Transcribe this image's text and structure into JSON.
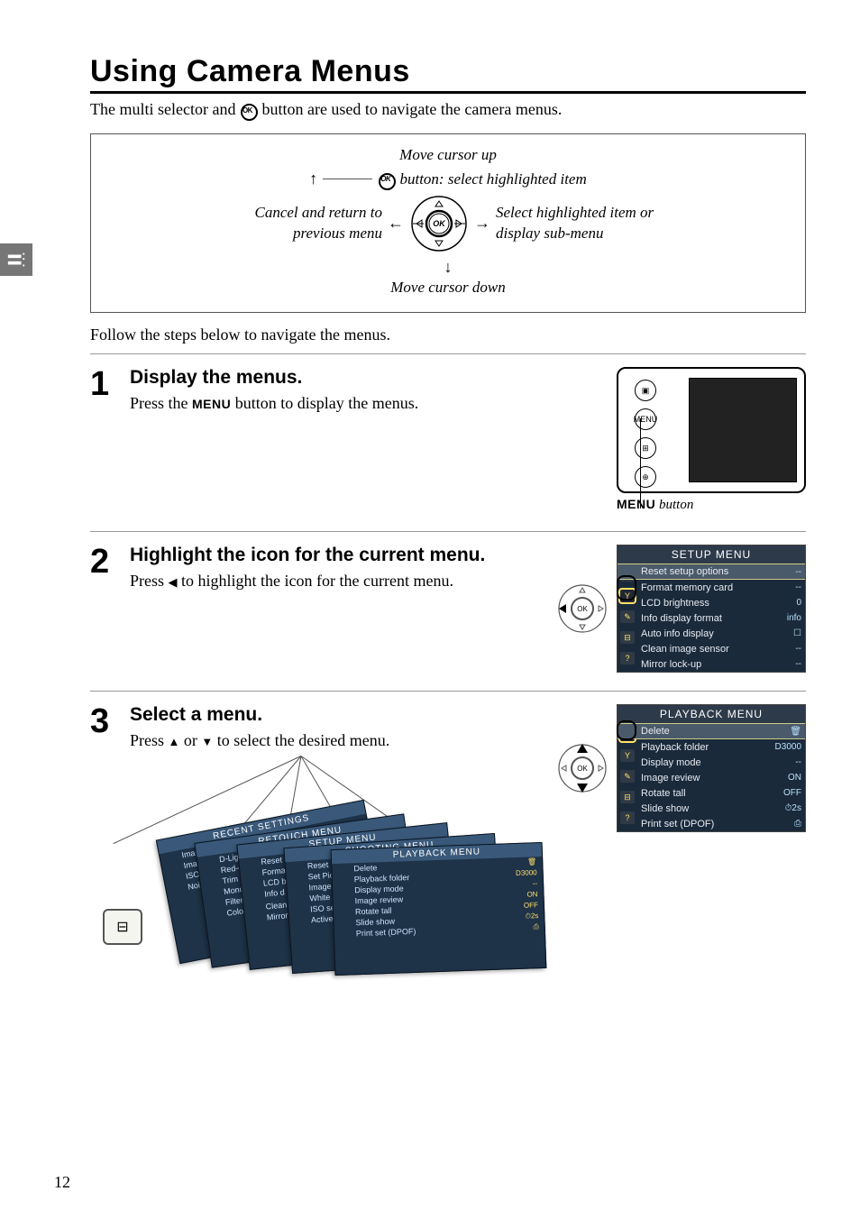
{
  "page_number": "12",
  "heading": "Using Camera Menus",
  "intro_pre": "The multi selector and ",
  "intro_post": " button are used to navigate the camera menus.",
  "diagram": {
    "up": "Move cursor up",
    "down": "Move cursor down",
    "ok": " button: select highlighted item",
    "right": "Select highlighted item or display sub-menu",
    "left": "Cancel and return to previous menu"
  },
  "follow": "Follow the steps below to navigate the menus.",
  "steps": [
    {
      "num": "1",
      "title": "Display the menus.",
      "text_pre": "Press the ",
      "text_mid": "MENU",
      "text_post": " button to display the menus.",
      "caption_pre": "MENU",
      "caption_post": " button"
    },
    {
      "num": "2",
      "title": "Highlight the icon for the current menu.",
      "text_pre": "Press ",
      "text_post": " to highlight the icon for the current menu."
    },
    {
      "num": "3",
      "title": "Select a menu.",
      "text_pre": "Press ",
      "text_mid": " or ",
      "text_post": " to select the desired menu."
    }
  ],
  "setup_menu": {
    "title": "SETUP MENU",
    "items": [
      {
        "label": "Reset setup options",
        "val": "--"
      },
      {
        "label": "Format memory card",
        "val": "--"
      },
      {
        "label": "LCD brightness",
        "val": "0"
      },
      {
        "label": "Info display format",
        "val": "info"
      },
      {
        "label": "Auto info display",
        "val": "☐"
      },
      {
        "label": "Clean image sensor",
        "val": "--"
      },
      {
        "label": "Mirror lock-up",
        "val": "--"
      }
    ]
  },
  "playback_menu": {
    "title": "PLAYBACK MENU",
    "items": [
      {
        "label": "Delete",
        "val": "🗑"
      },
      {
        "label": "Playback folder",
        "val": "D3000"
      },
      {
        "label": "Display mode",
        "val": "--"
      },
      {
        "label": "Image review",
        "val": "ON"
      },
      {
        "label": "Rotate tall",
        "val": "OFF"
      },
      {
        "label": "Slide show",
        "val": "⏱2s"
      },
      {
        "label": "Print set (DPOF)",
        "val": "⎙"
      }
    ]
  },
  "fan": {
    "cards": [
      {
        "title": "RECENT SETTINGS",
        "rows": [
          "Image quali",
          "Image size",
          "ISO sensitiv",
          "Noise reduc"
        ]
      },
      {
        "title": "RETOUCH MENU",
        "rows": [
          "D-Lighting",
          "Red-eye co",
          "Trim",
          "Monochron",
          "Filter",
          "Color"
        ]
      },
      {
        "title": "SETUP MENU",
        "rows": [
          "Reset setup",
          "Format me",
          "LCD br",
          "Info d",
          "",
          "Clean m",
          "Mirror lock"
        ]
      },
      {
        "title": "SHOOTING MENU",
        "rows": [
          "Reset",
          "Set Pic",
          "Image",
          "White bala",
          "ISO sensitiv",
          "Active D-Lig"
        ]
      },
      {
        "title": "PLAYBACK MENU",
        "rows": [
          {
            "l": "Delete",
            "v": "🗑"
          },
          {
            "l": "Playback folder",
            "v": "D3000"
          },
          {
            "l": "Display mode",
            "v": "--"
          },
          {
            "l": "Image review",
            "v": "ON"
          },
          {
            "l": "Rotate tall",
            "v": "OFF"
          },
          {
            "l": "Slide show",
            "v": "⏱2s"
          },
          {
            "l": "Print set (DPOF)",
            "v": "⎙"
          }
        ]
      }
    ]
  }
}
